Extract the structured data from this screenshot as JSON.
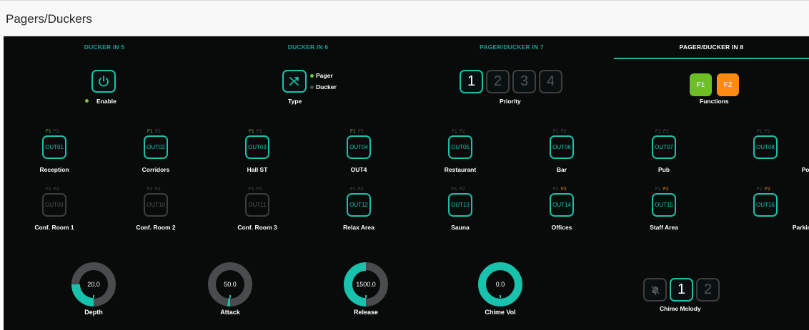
{
  "window": {
    "title": "Pagers/Duckers"
  },
  "tabs": [
    {
      "label": "DUCKER IN 5",
      "active": false
    },
    {
      "label": "DUCKER IN 6",
      "active": false
    },
    {
      "label": "PAGER/DUCKER IN 7",
      "active": false
    },
    {
      "label": "PAGER/DUCKER IN 8",
      "active": true
    }
  ],
  "controls": {
    "enable": {
      "label": "Enable",
      "icon": "power-icon",
      "enabled": true
    },
    "type": {
      "label": "Type",
      "icon": "shuffle-icon",
      "options": [
        "Pager",
        "Ducker"
      ],
      "selected": "Pager"
    },
    "priority": {
      "label": "Priority",
      "options": [
        "1",
        "2",
        "3",
        "4"
      ],
      "selected": "1"
    },
    "functions": {
      "label": "Functions",
      "f1": "F1",
      "f2": "F2",
      "f1_color": "#6cc024",
      "f2_color": "#ff8a12"
    }
  },
  "flag_labels": {
    "f1": "F1",
    "f2": "F2"
  },
  "flag_colors": {
    "on_f1": "#7ac143",
    "on_f2": "#ff9a1a",
    "off": "#4c4f52"
  },
  "outputs": [
    {
      "id": "OUT01",
      "name": "Reception",
      "active": true,
      "f1": true,
      "f2": false
    },
    {
      "id": "OUT02",
      "name": "Corridors",
      "active": true,
      "f1": true,
      "f2": false
    },
    {
      "id": "OUT03",
      "name": "Hall ST",
      "active": true,
      "f1": true,
      "f2": false
    },
    {
      "id": "OUT04",
      "name": "OUT4",
      "active": true,
      "f1": true,
      "f2": false
    },
    {
      "id": "OUT05",
      "name": "Restaurant",
      "active": true,
      "f1": false,
      "f2": false
    },
    {
      "id": "OUT06",
      "name": "Bar",
      "active": true,
      "f1": false,
      "f2": false
    },
    {
      "id": "OUT07",
      "name": "Pub",
      "active": true,
      "f1": false,
      "f2": false
    },
    {
      "id": "OUT08",
      "name": "Pool",
      "active": true,
      "f1": false,
      "f2": false
    },
    {
      "id": "OUT09",
      "name": "Conf. Room 1",
      "active": false,
      "f1": false,
      "f2": false
    },
    {
      "id": "OUT10",
      "name": "Conf. Room 2",
      "active": false,
      "f1": false,
      "f2": false
    },
    {
      "id": "OUT11",
      "name": "Conf. Room 3",
      "active": false,
      "f1": false,
      "f2": false
    },
    {
      "id": "OUT12",
      "name": "Relax Area",
      "active": true,
      "f1": false,
      "f2": false
    },
    {
      "id": "OUT13",
      "name": "Sauna",
      "active": true,
      "f1": false,
      "f2": false
    },
    {
      "id": "OUT14",
      "name": "Offices",
      "active": true,
      "f1": false,
      "f2": true
    },
    {
      "id": "OUT15",
      "name": "Staff Area",
      "active": true,
      "f1": false,
      "f2": true
    },
    {
      "id": "OUT16",
      "name": "Parking",
      "active": true,
      "f1": false,
      "f2": true
    }
  ],
  "knobs": [
    {
      "name": "depth",
      "label": "Depth",
      "value": "20.0",
      "fill": 0.25,
      "mode": "fill"
    },
    {
      "name": "attack",
      "label": "Attack",
      "value": "50.0",
      "fill": 0.02,
      "mode": "fill"
    },
    {
      "name": "release",
      "label": "Release",
      "value": "1500.0",
      "fill": 0.5,
      "mode": "fill"
    },
    {
      "name": "chime-vol",
      "label": "Chime Vol",
      "value": "0.0",
      "fill": 1.0,
      "mode": "full"
    }
  ],
  "chime_melody": {
    "label": "Chime Melody",
    "icon": "bell-off-icon",
    "options": [
      "1",
      "2"
    ],
    "selected": "1"
  },
  "colors": {
    "accent": "#19c2ac",
    "track": "#4a4b4d",
    "background": "#090b0b"
  }
}
